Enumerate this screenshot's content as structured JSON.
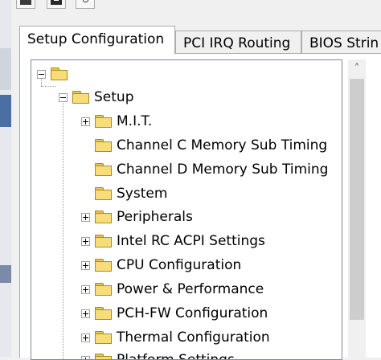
{
  "tabs": [
    {
      "label": "Setup Configuration",
      "active": true
    },
    {
      "label": "PCI IRQ Routing",
      "active": false
    },
    {
      "label": "BIOS Strin",
      "active": false
    }
  ],
  "tree": {
    "root": {
      "label": "",
      "expanded": true
    },
    "setup": {
      "label": "Setup",
      "expanded": true
    },
    "items": [
      {
        "label": "M.I.T.",
        "has_children": true
      },
      {
        "label": "Channel C Memory Sub Timing",
        "has_children": false
      },
      {
        "label": "Channel D Memory Sub Timing",
        "has_children": false
      },
      {
        "label": "System",
        "has_children": false
      },
      {
        "label": "Peripherals",
        "has_children": true
      },
      {
        "label": "Intel RC ACPI Settings",
        "has_children": true
      },
      {
        "label": "CPU Configuration",
        "has_children": true
      },
      {
        "label": "Power & Performance",
        "has_children": true
      },
      {
        "label": "PCH-FW Configuration",
        "has_children": true
      },
      {
        "label": "Thermal Configuration",
        "has_children": true
      },
      {
        "label": "Platform Settings",
        "has_children": true
      }
    ]
  },
  "icons": {
    "toolbar": [
      "open-folder-icon",
      "save-icon",
      "key-icon"
    ],
    "tree_folder": "folder-icon",
    "scroll_up": "chevron-up-icon"
  },
  "colors": {
    "folder_fill": "#f7dc7a",
    "folder_edge": "#b08a1c",
    "tab_active_bg": "#ffffff",
    "window_bg": "#f0f0f0",
    "scroll_thumb": "#cdcdcd"
  }
}
